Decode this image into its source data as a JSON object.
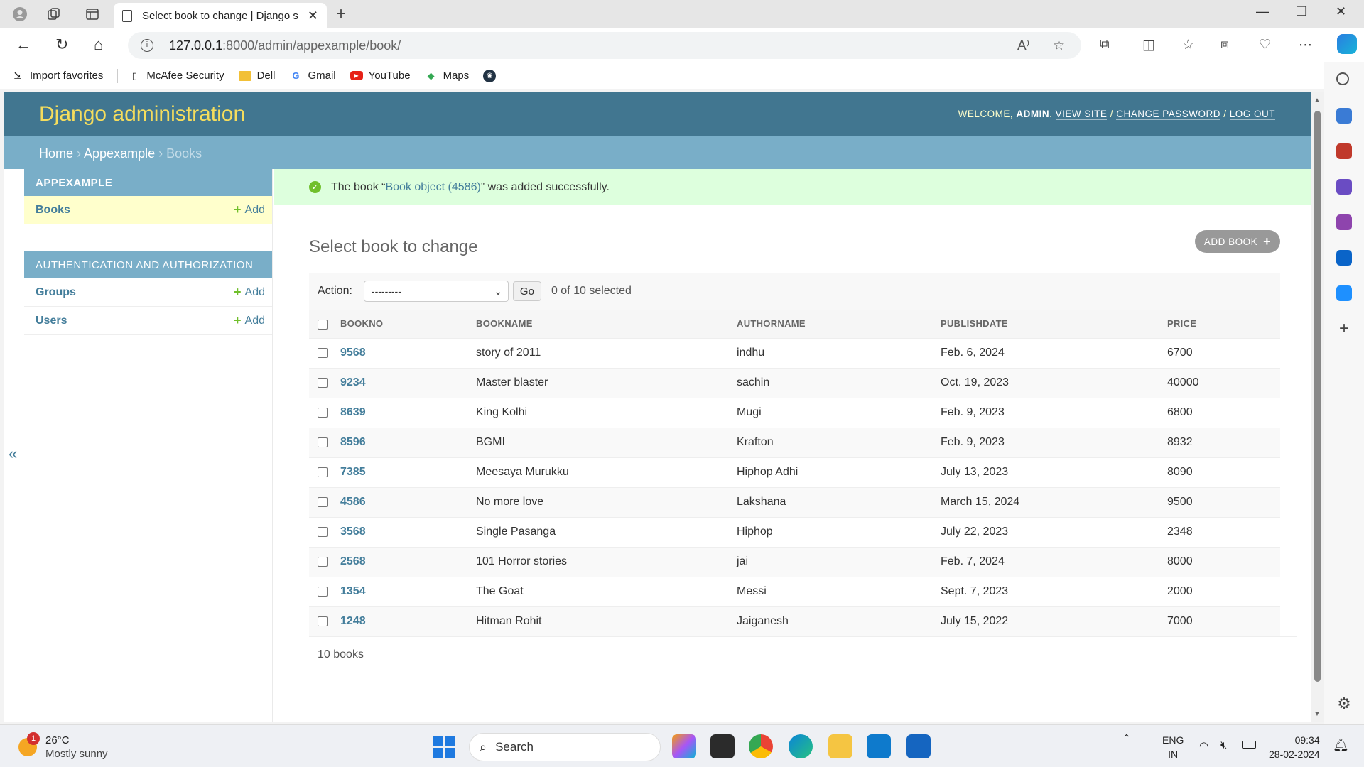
{
  "browser": {
    "tab_title": "Select book to change | Django s",
    "url_host": "127.0.0.1",
    "url_path": ":8000/admin/appexample/book/",
    "favorites": [
      "Import favorites",
      "McAfee Security",
      "Dell",
      "Gmail",
      "YouTube",
      "Maps"
    ]
  },
  "admin": {
    "brand": "Django administration",
    "welcome": "WELCOME,",
    "username": "ADMIN",
    "view_site": "VIEW SITE",
    "change_password": "CHANGE PASSWORD",
    "log_out": "LOG OUT",
    "breadcrumbs": {
      "home": "Home",
      "app": "Appexample",
      "current": "Books"
    }
  },
  "sidebar": {
    "modules": [
      {
        "caption": "APPEXAMPLE",
        "items": [
          {
            "label": "Books",
            "add": "Add"
          }
        ]
      },
      {
        "caption": "AUTHENTICATION AND AUTHORIZATION",
        "items": [
          {
            "label": "Groups",
            "add": "Add"
          },
          {
            "label": "Users",
            "add": "Add"
          }
        ]
      }
    ],
    "collapse": "«"
  },
  "message": {
    "prefix": "The book “",
    "link": "Book object (4586)",
    "suffix": "” was added successfully."
  },
  "page": {
    "title": "Select book to change",
    "add_button": "ADD BOOK",
    "action_label": "Action:",
    "action_value": "---------",
    "go": "Go",
    "selected": "0 of 10 selected",
    "paginator": "10 books"
  },
  "table": {
    "headers": [
      "BOOKNO",
      "BOOKNAME",
      "AUTHORNAME",
      "PUBLISHDATE",
      "PRICE"
    ],
    "rows": [
      [
        "9568",
        "story of 2011",
        "indhu",
        "Feb. 6, 2024",
        "6700"
      ],
      [
        "9234",
        "Master blaster",
        "sachin",
        "Oct. 19, 2023",
        "40000"
      ],
      [
        "8639",
        "King Kolhi",
        "Mugi",
        "Feb. 9, 2023",
        "6800"
      ],
      [
        "8596",
        "BGMI",
        "Krafton",
        "Feb. 9, 2023",
        "8932"
      ],
      [
        "7385",
        "Meesaya Murukku",
        "Hiphop Adhi",
        "July 13, 2023",
        "8090"
      ],
      [
        "4586",
        "No more love",
        "Lakshana",
        "March 15, 2024",
        "9500"
      ],
      [
        "3568",
        "Single Pasanga",
        "Hiphop",
        "July 22, 2023",
        "2348"
      ],
      [
        "2568",
        "101 Horror stories",
        "jai",
        "Feb. 7, 2024",
        "8000"
      ],
      [
        "1354",
        "The Goat",
        "Messi",
        "Sept. 7, 2023",
        "2000"
      ],
      [
        "1248",
        "Hitman Rohit",
        "Jaiganesh",
        "July 15, 2022",
        "7000"
      ]
    ]
  },
  "taskbar": {
    "weather_badge": "1",
    "temp": "26°C",
    "condition": "Mostly sunny",
    "search": "Search",
    "lang1": "ENG",
    "lang2": "IN",
    "time": "09:34",
    "date": "28-02-2024"
  }
}
